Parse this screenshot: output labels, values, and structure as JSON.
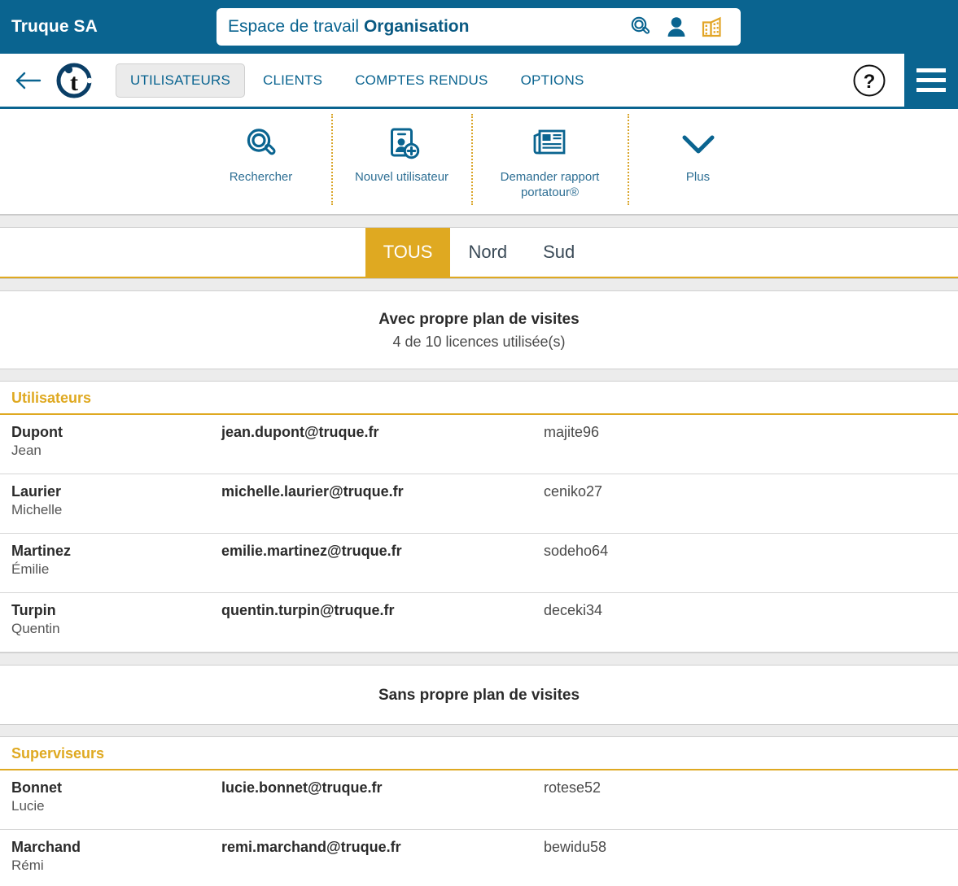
{
  "header": {
    "brand": "Truque SA",
    "workspace_prefix": "Espace de travail ",
    "workspace_name": "Organisation",
    "icons": {
      "search": "search-icon",
      "user": "user-icon",
      "company": "company-building-icon"
    }
  },
  "nav": {
    "back": "back-arrow-icon",
    "logo": "truque-t-logo",
    "tabs": [
      {
        "label": "UTILISATEURS",
        "active": true
      },
      {
        "label": "CLIENTS",
        "active": false
      },
      {
        "label": "COMPTES RENDUS",
        "active": false
      },
      {
        "label": "OPTIONS",
        "active": false
      }
    ],
    "help": "?",
    "menu": "hamburger-menu-icon"
  },
  "toolbar": {
    "items": [
      {
        "label": "Rechercher",
        "icon": "magnifier-icon"
      },
      {
        "label": "Nouvel utilisateur",
        "icon": "add-user-card-icon"
      },
      {
        "label": "Demander rapport portatour®",
        "icon": "newspaper-report-icon"
      },
      {
        "label": "Plus",
        "icon": "chevron-down-icon"
      }
    ]
  },
  "filters": {
    "tabs": [
      {
        "label": "TOUS",
        "active": true
      },
      {
        "label": "Nord",
        "active": false
      },
      {
        "label": "Sud",
        "active": false
      }
    ]
  },
  "sections": {
    "with_plan": {
      "title": "Avec propre plan de visites",
      "subtitle": "4 de 10 licences utilisée(s)",
      "group_label": "Utilisateurs",
      "rows": [
        {
          "lastname": "Dupont",
          "firstname": "Jean",
          "email": "jean.dupont@truque.fr",
          "username": "majite96"
        },
        {
          "lastname": "Laurier",
          "firstname": "Michelle",
          "email": "michelle.laurier@truque.fr",
          "username": "ceniko27"
        },
        {
          "lastname": "Martinez",
          "firstname": "Émilie",
          "email": "emilie.martinez@truque.fr",
          "username": "sodeho64"
        },
        {
          "lastname": "Turpin",
          "firstname": "Quentin",
          "email": "quentin.turpin@truque.fr",
          "username": "deceki34"
        }
      ]
    },
    "without_plan": {
      "title": "Sans propre plan de visites",
      "group_label": "Superviseurs",
      "rows": [
        {
          "lastname": "Bonnet",
          "firstname": "Lucie",
          "email": "lucie.bonnet@truque.fr",
          "username": "rotese52"
        },
        {
          "lastname": "Marchand",
          "firstname": "Rémi",
          "email": "remi.marchand@truque.fr",
          "username": "bewidu58"
        }
      ]
    }
  },
  "colors": {
    "brand_blue": "#0a6490",
    "accent_gold": "#dfa921",
    "text_dark": "#2b2b2b",
    "band_grey": "#ececec"
  }
}
